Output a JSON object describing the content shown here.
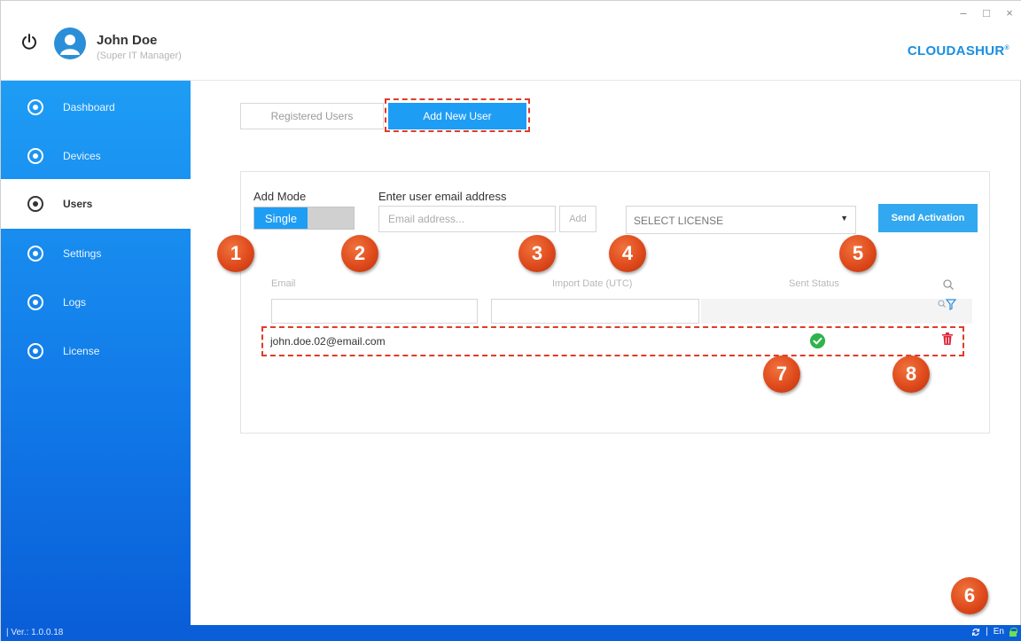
{
  "header": {
    "user_name": "John Doe",
    "user_role": "(Super IT Manager)",
    "brand": "CLOUDASHUR",
    "brand_mark": "®",
    "window_controls": [
      "–",
      "□",
      "×"
    ]
  },
  "sidebar": {
    "items": [
      {
        "label": "Dashboard",
        "icon": "dashboard-icon",
        "active": false
      },
      {
        "label": "Devices",
        "icon": "devices-icon",
        "active": false
      },
      {
        "label": "Users",
        "icon": "users-icon",
        "active": true
      },
      {
        "label": "Settings",
        "icon": "settings-icon",
        "active": false
      },
      {
        "label": "Logs",
        "icon": "logs-icon",
        "active": false
      },
      {
        "label": "License",
        "icon": "license-icon",
        "active": false
      }
    ]
  },
  "tabs": {
    "registered": "Registered Users",
    "add_new": "Add New User",
    "active": "add_new"
  },
  "form": {
    "add_mode_label": "Add Mode",
    "mode_value": "Single",
    "email_label": "Enter user email address",
    "email_placeholder": "Email address...",
    "add_button": "Add",
    "license_value": "SELECT LICENSE",
    "send_button": "Send Activation"
  },
  "table": {
    "columns": [
      "Email",
      "Import Date (UTC)",
      "Sent Status"
    ],
    "rows": [
      {
        "email": "john.doe.02@email.com",
        "status": "sent"
      }
    ]
  },
  "footer": {
    "version": "| Ver.: 1.0.0.18",
    "separator": "|",
    "language": "En"
  },
  "callouts": [
    "1",
    "2",
    "3",
    "4",
    "5",
    "6",
    "7",
    "8"
  ],
  "colors": {
    "primary": "#1e9df5",
    "sidebar_bottom": "#0a5fd8",
    "callout": "#df4a1c",
    "highlight_dash": "#e03b2b",
    "success": "#2fb34b",
    "delete": "#e02b3b"
  }
}
